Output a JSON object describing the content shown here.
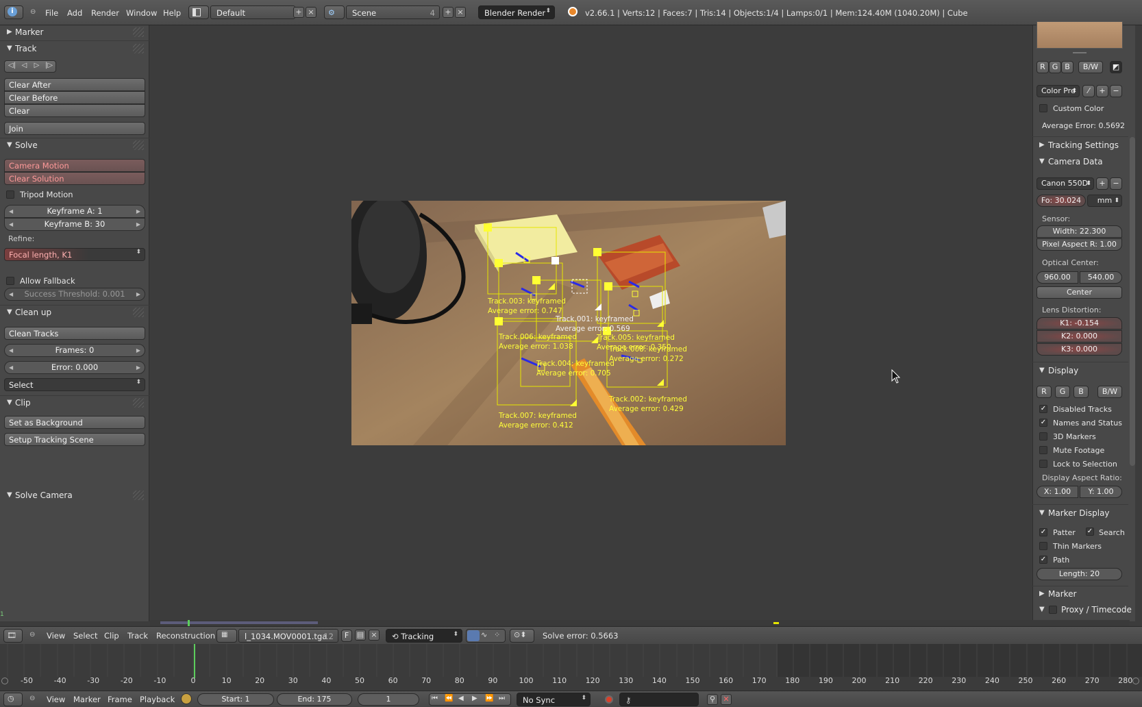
{
  "topbar": {
    "menus": [
      "File",
      "Add",
      "Render",
      "Window",
      "Help"
    ],
    "screen_layout": "Default",
    "scene": "Scene",
    "scene_users": "4",
    "render_engine": "Blender Render",
    "stats": "v2.66.1 | Verts:12 | Faces:7 | Tris:14 | Objects:1/4 | Lamps:0/1 | Mem:124.40M (1040.20M) | Cube"
  },
  "left": {
    "marker": "Marker",
    "track": "Track",
    "clear_after": "Clear After",
    "clear_before": "Clear Before",
    "clear": "Clear",
    "join": "Join",
    "solve": "Solve",
    "camera_motion": "Camera Motion",
    "clear_solution": "Clear Solution",
    "tripod_motion": "Tripod Motion",
    "keyframe_a": "Keyframe A: 1",
    "keyframe_b": "Keyframe B: 30",
    "refine_label": "Refine:",
    "refine_value": "Focal length, K1",
    "allow_fallback": "Allow Fallback",
    "success_threshold": "Success Threshold: 0.001",
    "clean_up": "Clean up",
    "clean_tracks": "Clean Tracks",
    "frames": "Frames: 0",
    "error": "Error: 0.000",
    "select": "Select",
    "clip": "Clip",
    "set_background": "Set as Background",
    "setup_scene": "Setup Tracking Scene",
    "solve_camera": "Solve Camera"
  },
  "tracks": [
    {
      "name": "Track.003: keyframed",
      "err": "Average error: 0.747",
      "color": "#ffff3a"
    },
    {
      "name": "Track.001: keyframed",
      "err": "Average error: 0.569",
      "color": "#f2f2f2"
    },
    {
      "name": "Track.006: keyframed",
      "err": "Average error: 1.038",
      "color": "#ffff3a"
    },
    {
      "name": "Track.005: keyframed",
      "err": "Average error: 0.350",
      "color": "#ffff3a"
    },
    {
      "name": "Track.004: keyframed",
      "err": "Average error: 0.705",
      "color": "#ffff3a"
    },
    {
      "name": "Track.008: keyframed",
      "err": "Average error: 0.272",
      "color": "#ffff3a"
    },
    {
      "name": "Track.002: keyframed",
      "err": "Average error: 0.429",
      "color": "#ffff3a"
    },
    {
      "name": "Track.007: keyframed",
      "err": "Average error: 0.412",
      "color": "#ffff3a"
    }
  ],
  "right": {
    "r": "R",
    "g": "G",
    "b": "B",
    "bw": "B/W",
    "color_preset": "Color Pre",
    "custom_color": "Custom Color",
    "avg_error": "Average Error: 0.5692",
    "tracking_settings": "Tracking Settings",
    "camera_data": "Camera Data",
    "camera_preset": "Canon 550D",
    "focal": "Fo: 30.024",
    "focal_unit": "mm",
    "sensor": "Sensor:",
    "width": "Width: 22.300",
    "pixel_aspect": "Pixel Aspect R: 1.00",
    "optical_center": "Optical Center:",
    "ox": "960.00",
    "oy": "540.00",
    "center": "Center",
    "lens_distortion": "Lens Distortion:",
    "k1": "K1: -0.154",
    "k2": "K2: 0.000",
    "k3": "K3: 0.000",
    "display": "Display",
    "disabled_tracks": "Disabled Tracks",
    "names_status": "Names and Status",
    "markers_3d": "3D Markers",
    "mute_footage": "Mute Footage",
    "lock_selection": "Lock to Selection",
    "display_aspect": "Display Aspect Ratio:",
    "ax": "X: 1.00",
    "ay": "Y: 1.00",
    "marker_display": "Marker Display",
    "pattern": "Patter",
    "search": "Search",
    "thin_markers": "Thin Markers",
    "path": "Path",
    "length": "Length: 20",
    "marker": "Marker",
    "proxy": "Proxy / Timecode"
  },
  "clip_header": {
    "menus": [
      "View",
      "Select",
      "Clip",
      "Track",
      "Reconstruction"
    ],
    "clip_name": "l_1034.MOV0001.tga",
    "clip_users": "12",
    "fake": "F",
    "mode": "Tracking",
    "solve_error": "Solve error: 0.5663"
  },
  "timeline": {
    "ticks": [
      "-50",
      "-40",
      "-30",
      "-20",
      "-10",
      "0",
      "10",
      "20",
      "30",
      "40",
      "50",
      "60",
      "70",
      "80",
      "90",
      "100",
      "110",
      "120",
      "130",
      "140",
      "150",
      "160",
      "170",
      "180",
      "190",
      "200",
      "210",
      "220",
      "230",
      "240",
      "250",
      "260",
      "270",
      "280"
    ],
    "current_frame": "1",
    "frame_marker": "1"
  },
  "bottombar": {
    "menus": [
      "View",
      "Marker",
      "Frame",
      "Playback"
    ],
    "start": "Start: 1",
    "end": "End: 175",
    "frame": "1",
    "sync": "No Sync"
  }
}
